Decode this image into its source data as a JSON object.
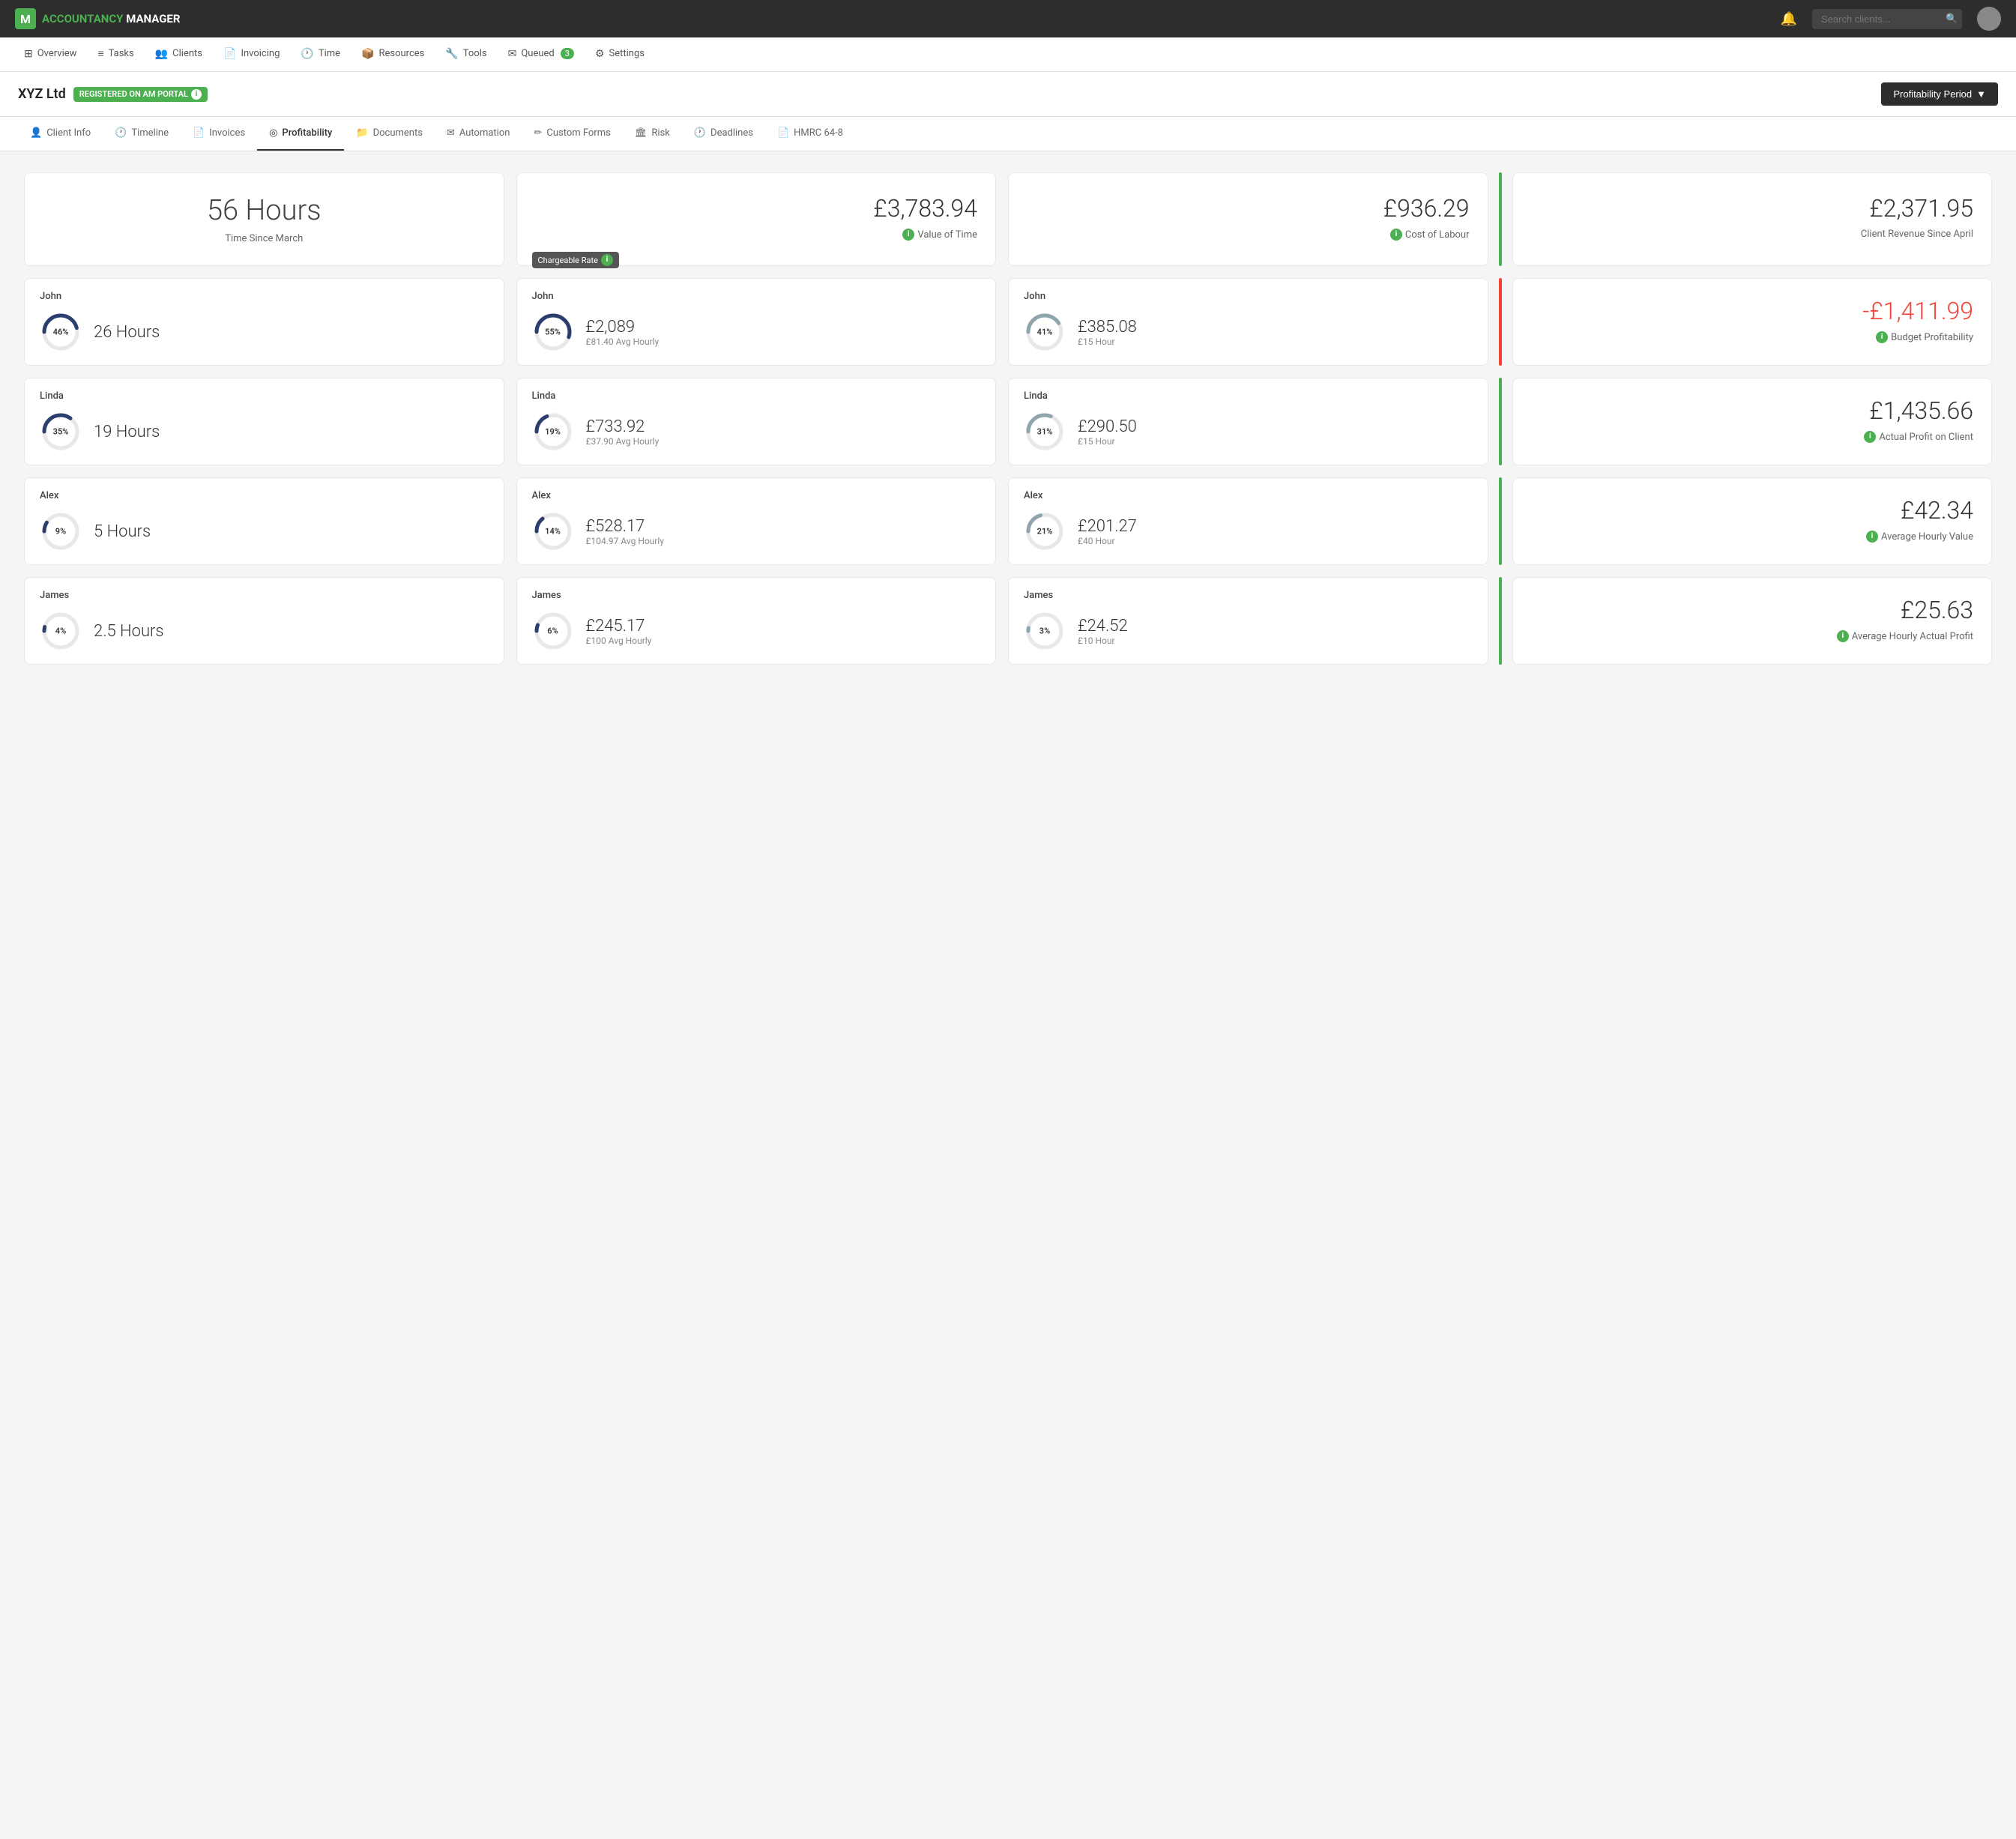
{
  "app": {
    "logo_text": "ACCOUNTANCY",
    "logo_sub": "MANAGER",
    "search_placeholder": "Search clients..."
  },
  "nav": {
    "items": [
      {
        "label": "Overview",
        "icon": "⊞"
      },
      {
        "label": "Tasks",
        "icon": "☰"
      },
      {
        "label": "Clients",
        "icon": "👥"
      },
      {
        "label": "Invoicing",
        "icon": "📄"
      },
      {
        "label": "Time",
        "icon": "🕐"
      },
      {
        "label": "Resources",
        "icon": "📦"
      },
      {
        "label": "Tools",
        "icon": "🔧"
      },
      {
        "label": "Queued",
        "icon": "✉",
        "badge": "3"
      },
      {
        "label": "Settings",
        "icon": "⚙"
      }
    ]
  },
  "client": {
    "name": "XYZ Ltd",
    "portal_badge": "REGISTERED ON AM PORTAL",
    "period_button": "Profitability Period"
  },
  "tabs": [
    {
      "label": "Client Info",
      "icon": "👤",
      "active": false
    },
    {
      "label": "Timeline",
      "icon": "🕐",
      "active": false
    },
    {
      "label": "Invoices",
      "icon": "📄",
      "active": false
    },
    {
      "label": "Profitability",
      "icon": "◎",
      "active": true
    },
    {
      "label": "Documents",
      "icon": "📁",
      "active": false
    },
    {
      "label": "Automation",
      "icon": "✉",
      "active": false
    },
    {
      "label": "Custom Forms",
      "icon": "✏",
      "active": false
    },
    {
      "label": "Risk",
      "icon": "🏛",
      "active": false
    },
    {
      "label": "Deadlines",
      "icon": "🕐",
      "active": false
    },
    {
      "label": "HMRC 64-8",
      "icon": "📄",
      "active": false
    }
  ],
  "summary": {
    "hours": {
      "value": "56 Hours",
      "label": "Time Since March"
    },
    "value_of_time": {
      "value": "£3,783.94",
      "label": "Value of Time",
      "tooltip": "Chargeable Rate"
    },
    "cost_of_labour": {
      "value": "£936.29",
      "label": "Cost of Labour"
    },
    "client_revenue": {
      "value": "£2,371.95",
      "label": "Client Revenue Since April"
    }
  },
  "right_cards": [
    {
      "value": "-£1,411.99",
      "label": "Budget Profitability",
      "negative": true
    },
    {
      "value": "£1,435.66",
      "label": "Actual Profit on Client",
      "negative": false
    },
    {
      "value": "£42.34",
      "label": "Average Hourly Value",
      "negative": false
    },
    {
      "value": "£25.63",
      "label": "Average Hourly Actual Profit",
      "negative": false
    }
  ],
  "dividers": [
    "green",
    "red",
    "green",
    "green",
    "green"
  ],
  "people": [
    {
      "name": "John",
      "hours_pct": 46,
      "hours": "26 Hours",
      "value_pct": 55,
      "value": "£2,089",
      "value_sub": "£81.40 Avg Hourly",
      "cost_pct": 41,
      "cost": "£385.08",
      "cost_sub": "£15 Hour"
    },
    {
      "name": "Linda",
      "hours_pct": 35,
      "hours": "19 Hours",
      "value_pct": 19,
      "value": "£733.92",
      "value_sub": "£37.90 Avg Hourly",
      "cost_pct": 31,
      "cost": "£290.50",
      "cost_sub": "£15 Hour"
    },
    {
      "name": "Alex",
      "hours_pct": 9,
      "hours": "5 Hours",
      "value_pct": 14,
      "value": "£528.17",
      "value_sub": "£104.97 Avg Hourly",
      "cost_pct": 21,
      "cost": "£201.27",
      "cost_sub": "£40 Hour"
    },
    {
      "name": "James",
      "hours_pct": 4,
      "hours": "2.5 Hours",
      "value_pct": 6,
      "value": "£245.17",
      "value_sub": "£100 Avg Hourly",
      "cost_pct": 3,
      "cost": "£24.52",
      "cost_sub": "£10 Hour"
    }
  ]
}
